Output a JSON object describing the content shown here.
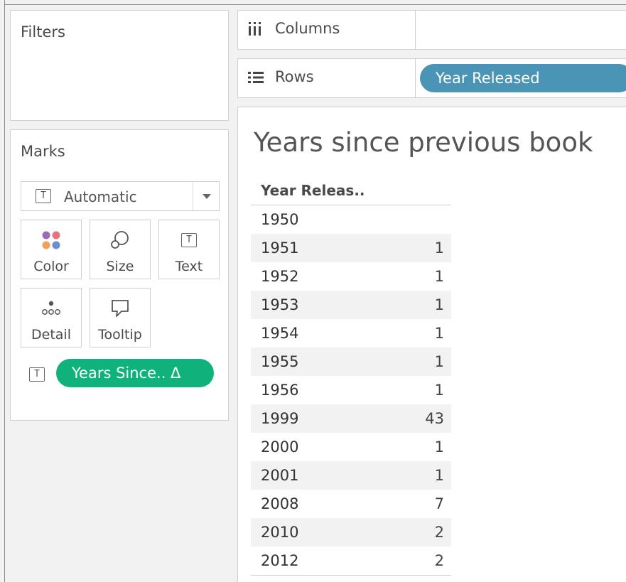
{
  "filters": {
    "title": "Filters"
  },
  "marks": {
    "title": "Marks",
    "mark_type": "Automatic",
    "cards": [
      {
        "label": "Color",
        "icon": "color-icon"
      },
      {
        "label": "Size",
        "icon": "size-icon"
      },
      {
        "label": "Text",
        "icon": "text-icon"
      },
      {
        "label": "Detail",
        "icon": "detail-icon"
      },
      {
        "label": "Tooltip",
        "icon": "tooltip-icon"
      }
    ],
    "text_pill": "Years Since.. Δ"
  },
  "shelves": {
    "columns": {
      "label": "Columns",
      "icon": "columns-icon"
    },
    "rows": {
      "label": "Rows",
      "icon": "rows-icon",
      "pill": "Year Released"
    }
  },
  "viz": {
    "title": "Years since previous book",
    "header": "Year Releas..",
    "rows": [
      {
        "year": "1950",
        "value": ""
      },
      {
        "year": "1951",
        "value": "1"
      },
      {
        "year": "1952",
        "value": "1"
      },
      {
        "year": "1953",
        "value": "1"
      },
      {
        "year": "1954",
        "value": "1"
      },
      {
        "year": "1955",
        "value": "1"
      },
      {
        "year": "1956",
        "value": "1"
      },
      {
        "year": "1999",
        "value": "43"
      },
      {
        "year": "2000",
        "value": "1"
      },
      {
        "year": "2001",
        "value": "1"
      },
      {
        "year": "2008",
        "value": "7"
      },
      {
        "year": "2010",
        "value": "2"
      },
      {
        "year": "2012",
        "value": "2"
      }
    ]
  },
  "colors": {
    "green_pill": "#10b27b",
    "blue_pill": "#4a94b5",
    "color_dots": [
      "#9b6bb5",
      "#e8737a",
      "#f0a05a",
      "#6a8fd0"
    ]
  }
}
